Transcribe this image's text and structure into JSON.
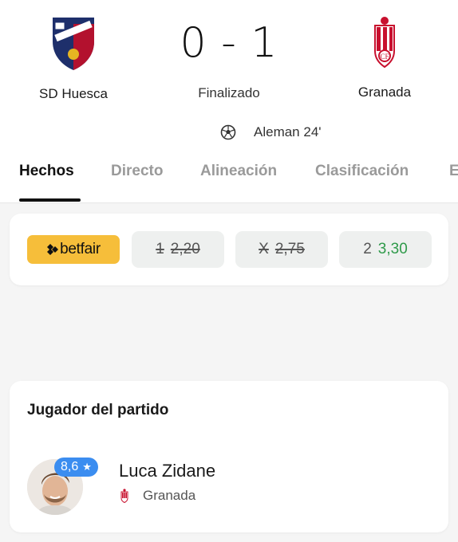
{
  "match": {
    "home": {
      "name": "SD Huesca",
      "crest": "sd-huesca-crest-icon"
    },
    "away": {
      "name": "Granada",
      "crest": "granada-crest-icon"
    },
    "score": "0 - 1",
    "status": "Finalizado",
    "goals": [
      {
        "icon": "soccer-ball-icon",
        "text": "Aleman 24'"
      }
    ]
  },
  "tabs": [
    {
      "label": "Hechos",
      "active": true
    },
    {
      "label": "Directo"
    },
    {
      "label": "Alineación"
    },
    {
      "label": "Clasificación"
    },
    {
      "label": "E"
    }
  ],
  "odds": {
    "bookmaker": "betfair",
    "items": [
      {
        "label": "1",
        "value": "2,20",
        "struck": true
      },
      {
        "label": "X",
        "value": "2,75",
        "struck": true
      },
      {
        "label": "2",
        "value": "3,30",
        "struck": false
      }
    ]
  },
  "player_of_match": {
    "title": "Jugador del partido",
    "name": "Luca Zidane",
    "rating": "8,6",
    "team": "Granada"
  },
  "colors": {
    "accent_blue": "#3b8df0",
    "betfair_yellow": "#f6be3a",
    "odds_green": "#2f9a4a"
  }
}
